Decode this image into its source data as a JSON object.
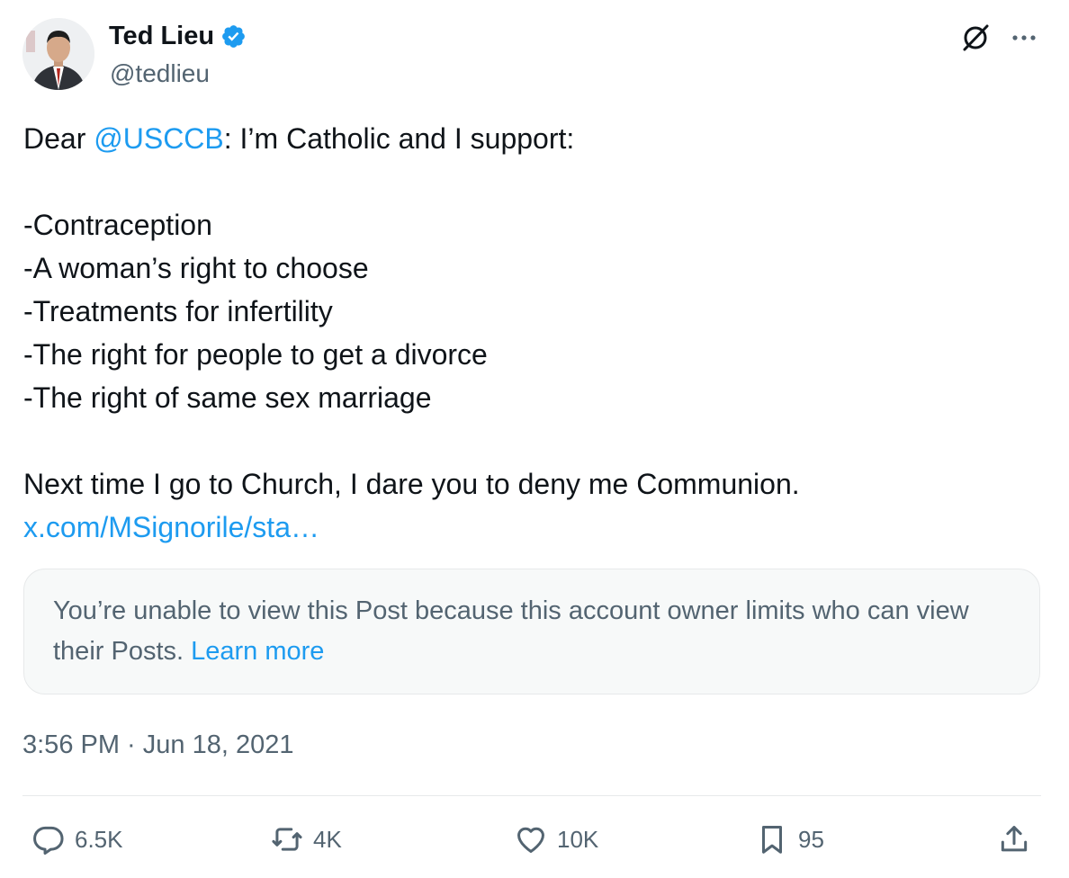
{
  "author": {
    "name": "Ted Lieu",
    "handle": "@tedlieu"
  },
  "tweet": {
    "lines": [
      {
        "before": "Dear ",
        "mention": "@USCCB",
        "after": ": I’m Catholic and I support:"
      },
      {
        "text": ""
      },
      {
        "text": "-Contraception"
      },
      {
        "text": "-A woman’s right to choose"
      },
      {
        "text": "-Treatments for infertility"
      },
      {
        "text": "-The right for people to get a divorce"
      },
      {
        "text": "-The right of same sex marriage"
      },
      {
        "text": ""
      },
      {
        "text": "Next time I go to Church, I dare you to deny me Communion."
      }
    ],
    "link": "x.com/MSignorile/sta…"
  },
  "quote": {
    "message": "You’re unable to view this Post because this account owner limits who can view their Posts.",
    "learn_more": "Learn more"
  },
  "timestamp": "3:56 PM · Jun 18, 2021",
  "actions": {
    "replies": "6.5K",
    "reposts": "4K",
    "likes": "10K",
    "bookmarks": "95"
  },
  "colors": {
    "link": "#1d9bf0",
    "secondary_text": "#536471",
    "verified_badge": "#1d9bf0"
  },
  "icons": [
    "verified-badge-icon",
    "grok-icon",
    "more-icon",
    "reply-icon",
    "repost-icon",
    "like-icon",
    "bookmark-icon",
    "share-icon"
  ]
}
